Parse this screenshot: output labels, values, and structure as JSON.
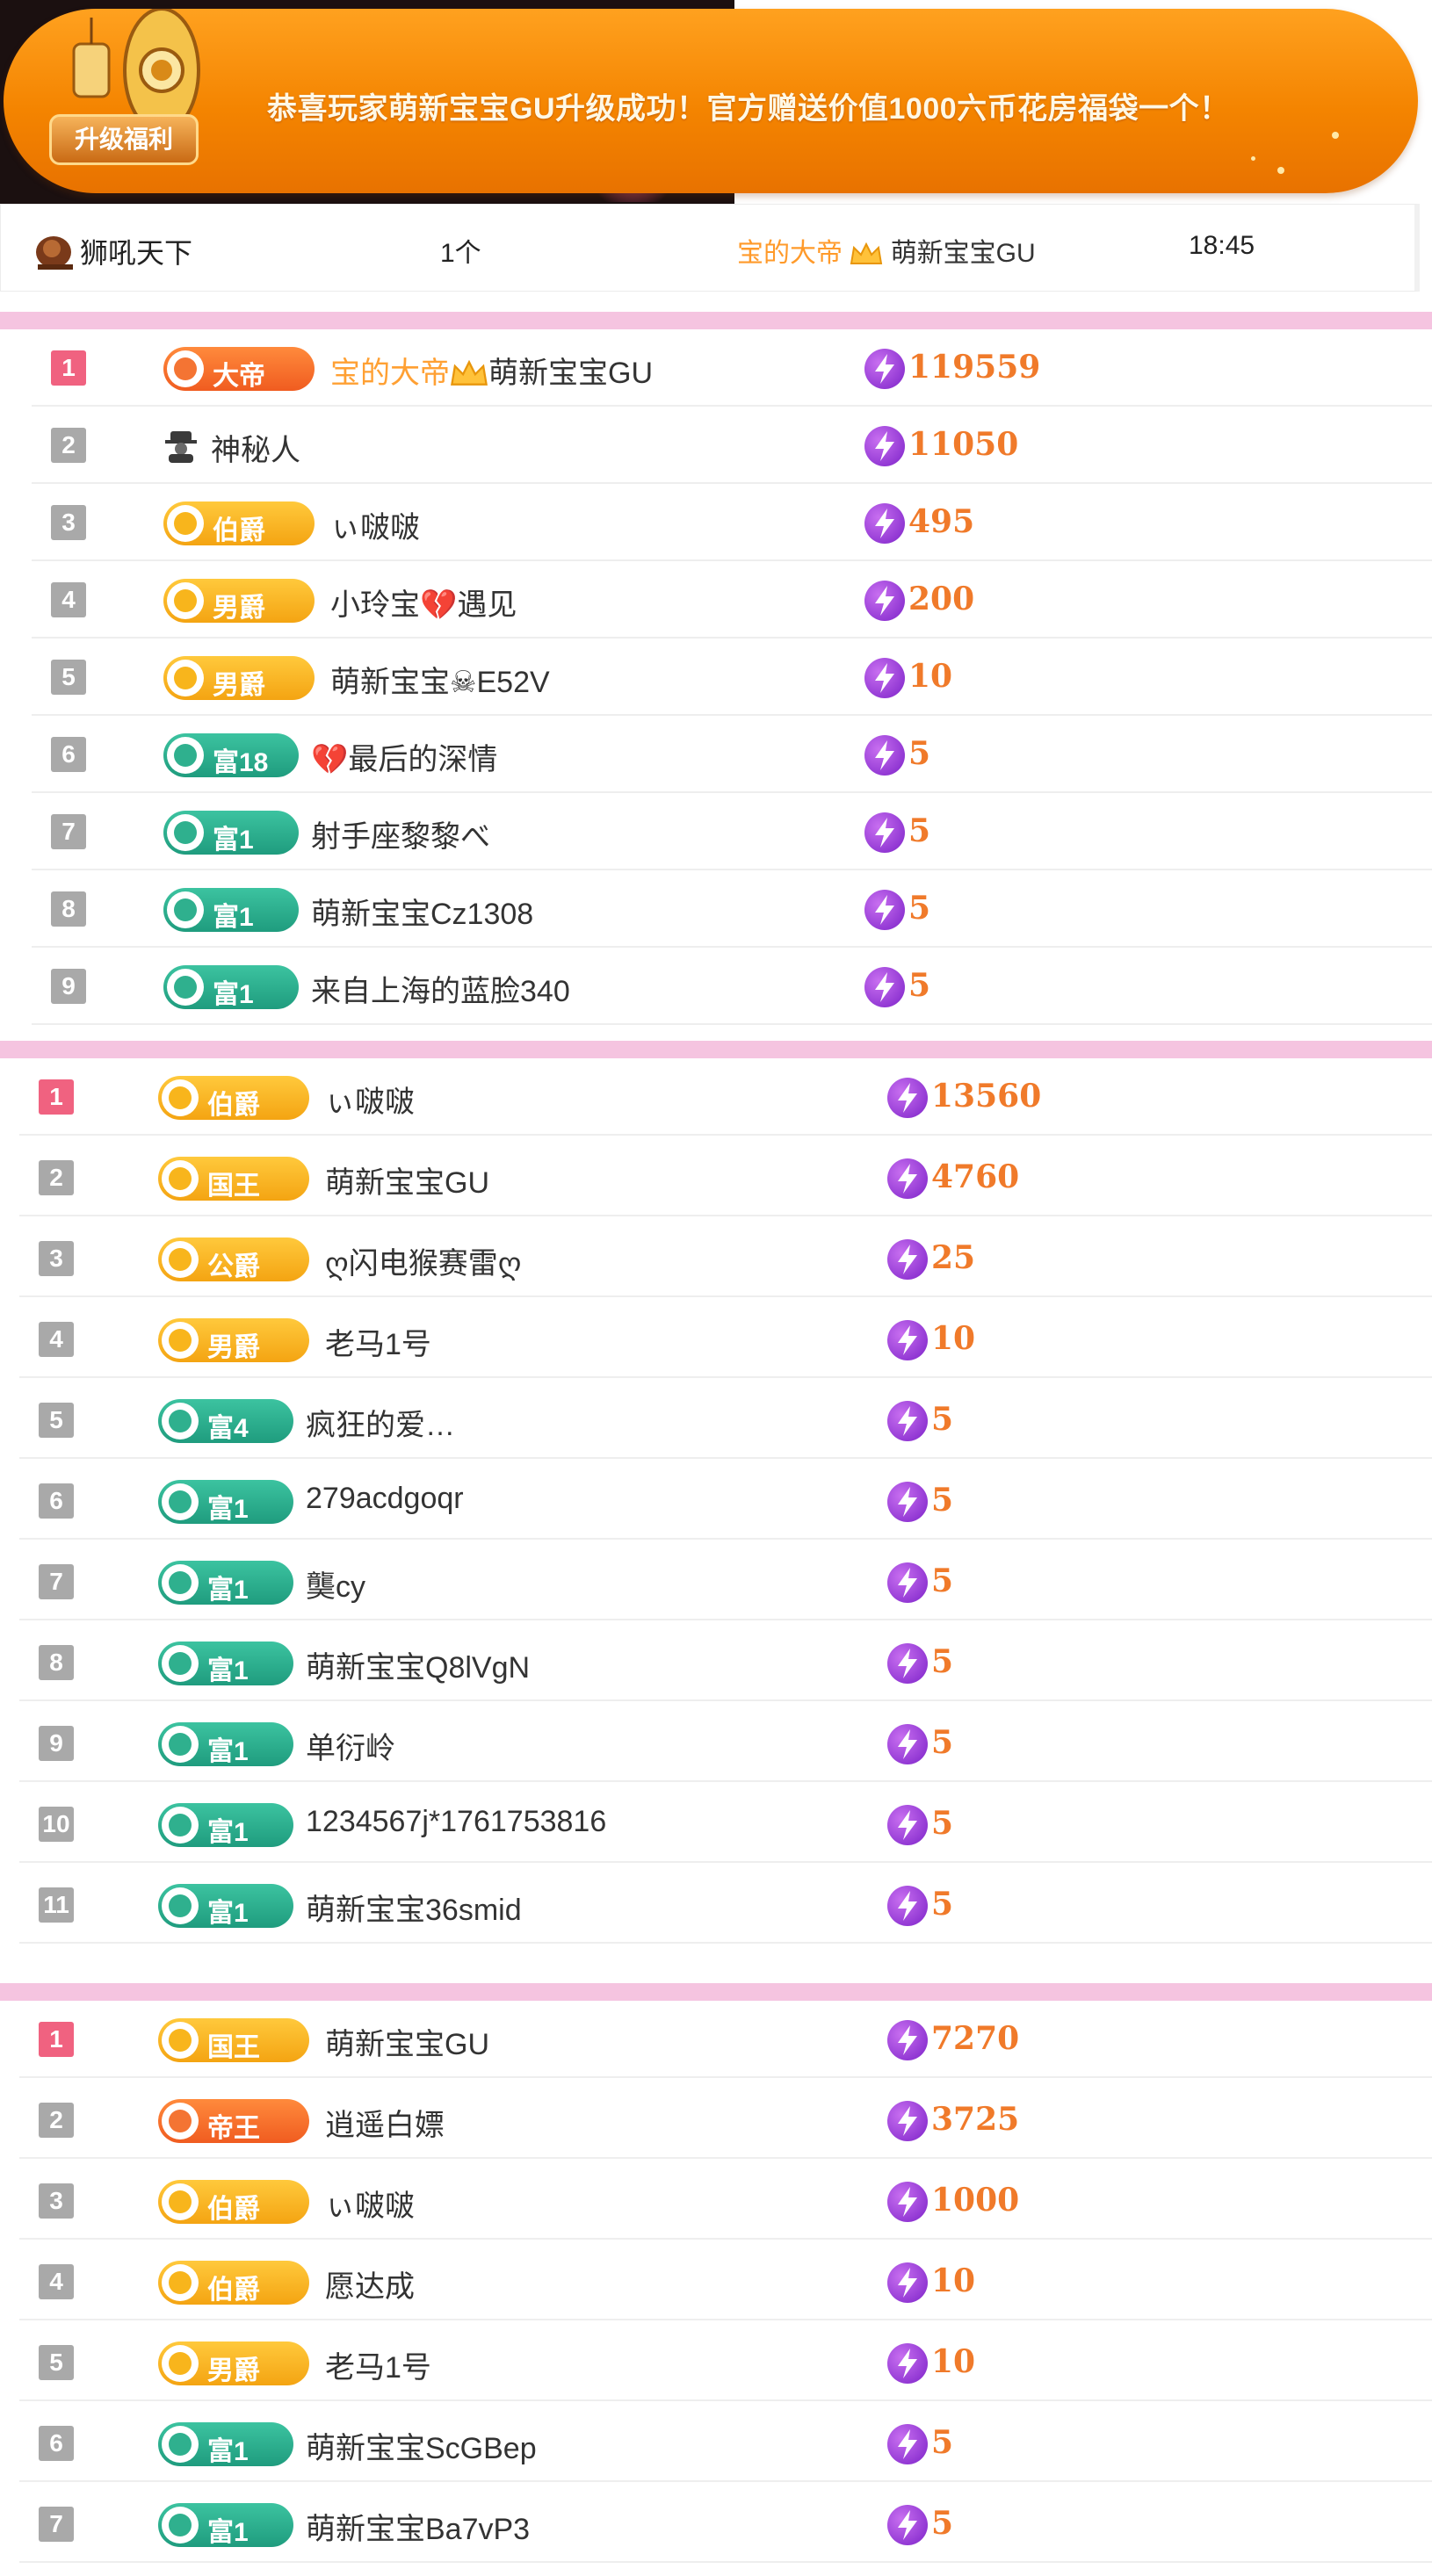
{
  "banner": {
    "badge_label": "升级福利",
    "message": "恭喜玩家萌新宝宝GU升级成功！官方赠送价值1000六币花房福袋一个！"
  },
  "info_row": {
    "user": "狮吼天下",
    "count": "1个",
    "receiver_prefix": "宝的大帝",
    "receiver_name": "萌新宝宝GU",
    "time": "18:45"
  },
  "colors": {
    "rank_first": "#f06280",
    "rank_other": "#a9a9a9",
    "score": "#f07a2a",
    "separator": "#f5c4e0"
  },
  "list1": [
    {
      "rank": "1",
      "badge": "大帝",
      "badge_style": "orange",
      "name_prefix": "宝的大帝",
      "name": "萌新宝宝GU",
      "score": "119559"
    },
    {
      "rank": "2",
      "badge": "",
      "badge_style": "incognito",
      "name_prefix": "",
      "name": "神秘人",
      "score": "11050"
    },
    {
      "rank": "3",
      "badge": "伯爵",
      "badge_style": "gold",
      "name_prefix": "",
      "name": "ぃ啵啵",
      "score": "495"
    },
    {
      "rank": "4",
      "badge": "男爵",
      "badge_style": "gold",
      "name_prefix": "",
      "name": "小玲宝💔遇见",
      "score": "200"
    },
    {
      "rank": "5",
      "badge": "男爵",
      "badge_style": "gold",
      "name_prefix": "",
      "name": "萌新宝宝☠E52V",
      "score": "10"
    },
    {
      "rank": "6",
      "badge": "富18",
      "badge_style": "teal",
      "name_prefix": "",
      "name": "💔最后的深情",
      "score": "5"
    },
    {
      "rank": "7",
      "badge": "富1",
      "badge_style": "teal",
      "name_prefix": "",
      "name": "射手座黎黎べ",
      "score": "5"
    },
    {
      "rank": "8",
      "badge": "富1",
      "badge_style": "teal",
      "name_prefix": "",
      "name": "萌新宝宝Cz1308",
      "score": "5"
    },
    {
      "rank": "9",
      "badge": "富1",
      "badge_style": "teal",
      "name_prefix": "",
      "name": "来自上海的蓝脸340",
      "score": "5"
    }
  ],
  "list2": [
    {
      "rank": "1",
      "badge": "伯爵",
      "badge_style": "gold",
      "name": "ぃ啵啵",
      "score": "13560"
    },
    {
      "rank": "2",
      "badge": "国王",
      "badge_style": "gold",
      "name": "萌新宝宝GU",
      "score": "4760"
    },
    {
      "rank": "3",
      "badge": "公爵",
      "badge_style": "gold",
      "name": "ღ闪电猴赛雷ღ",
      "score": "25"
    },
    {
      "rank": "4",
      "badge": "男爵",
      "badge_style": "gold",
      "name": "老马1号",
      "score": "10"
    },
    {
      "rank": "5",
      "badge": "富4",
      "badge_style": "teal",
      "name": "疯狂的爱…",
      "score": "5"
    },
    {
      "rank": "6",
      "badge": "富1",
      "badge_style": "teal",
      "name": "279acdgoqr",
      "score": "5"
    },
    {
      "rank": "7",
      "badge": "富1",
      "badge_style": "teal",
      "name": "龑cy",
      "score": "5"
    },
    {
      "rank": "8",
      "badge": "富1",
      "badge_style": "teal",
      "name": "萌新宝宝Q8lVgN",
      "score": "5"
    },
    {
      "rank": "9",
      "badge": "富1",
      "badge_style": "teal",
      "name": "单衍岭",
      "score": "5"
    },
    {
      "rank": "10",
      "badge": "富1",
      "badge_style": "teal",
      "name": "1234567j*1761753816",
      "score": "5"
    },
    {
      "rank": "11",
      "badge": "富1",
      "badge_style": "teal",
      "name": "萌新宝宝36smid",
      "score": "5"
    }
  ],
  "list3": [
    {
      "rank": "1",
      "badge": "国王",
      "badge_style": "gold",
      "name": "萌新宝宝GU",
      "score": "7270"
    },
    {
      "rank": "2",
      "badge": "帝王",
      "badge_style": "orange",
      "name": "逍遥白嫖",
      "score": "3725"
    },
    {
      "rank": "3",
      "badge": "伯爵",
      "badge_style": "gold",
      "name": "ぃ啵啵",
      "score": "1000"
    },
    {
      "rank": "4",
      "badge": "伯爵",
      "badge_style": "gold",
      "name": "愿达成",
      "score": "10"
    },
    {
      "rank": "5",
      "badge": "男爵",
      "badge_style": "gold",
      "name": "老马1号",
      "score": "10"
    },
    {
      "rank": "6",
      "badge": "富1",
      "badge_style": "teal",
      "name": "萌新宝宝ScGBep",
      "score": "5"
    },
    {
      "rank": "7",
      "badge": "富1",
      "badge_style": "teal",
      "name": "萌新宝宝Ba7vP3",
      "score": "5"
    }
  ]
}
